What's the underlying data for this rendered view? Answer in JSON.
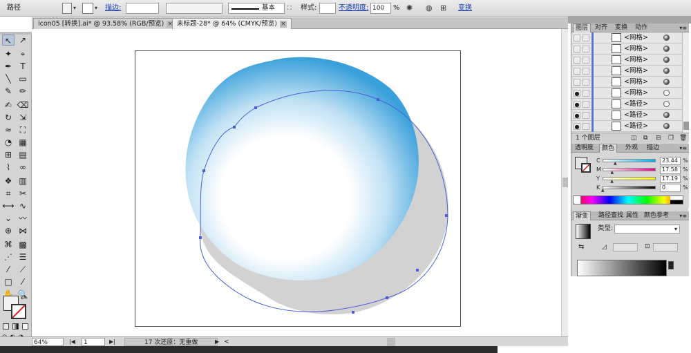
{
  "control_bar": {
    "selection_label": "路径",
    "stroke_label": "描边:",
    "brush_label": "基本",
    "style_label": "样式:",
    "opacity_label": "不透明度:",
    "opacity_value": "100",
    "opacity_unit": "%",
    "transform_link": "变换"
  },
  "tabs": [
    {
      "label": "icon05 [转换].ai* @ 93.58% (RGB/预览)",
      "active": false
    },
    {
      "label": "未标题-28* @ 64% (CMYK/预览)",
      "active": true
    }
  ],
  "tab_close_glyph": "×",
  "tools": [
    {
      "name": "selection-tool-icon",
      "glyph": "↖",
      "selected": true
    },
    {
      "name": "direct-selection-tool-icon",
      "glyph": "↗"
    },
    {
      "name": "magic-wand-tool-icon",
      "glyph": "✦"
    },
    {
      "name": "lasso-tool-icon",
      "glyph": "⌖"
    },
    {
      "name": "pen-tool-icon",
      "glyph": "✒"
    },
    {
      "name": "type-tool-icon",
      "glyph": "T"
    },
    {
      "name": "line-tool-icon",
      "glyph": "╲"
    },
    {
      "name": "rectangle-tool-icon",
      "glyph": "▭"
    },
    {
      "name": "paintbrush-tool-icon",
      "glyph": "✎"
    },
    {
      "name": "pencil-tool-icon",
      "glyph": "✏"
    },
    {
      "name": "blob-brush-tool-icon",
      "glyph": "✍"
    },
    {
      "name": "eraser-tool-icon",
      "glyph": "⌫"
    },
    {
      "name": "rotate-tool-icon",
      "glyph": "↻"
    },
    {
      "name": "scale-tool-icon",
      "glyph": "⇲"
    },
    {
      "name": "warp-tool-icon",
      "glyph": "≈"
    },
    {
      "name": "free-transform-tool-icon",
      "glyph": "⛶"
    },
    {
      "name": "shape-builder-tool-icon",
      "glyph": "◔"
    },
    {
      "name": "perspective-grid-tool-icon",
      "glyph": "▦"
    },
    {
      "name": "mesh-tool-icon",
      "glyph": "⊞"
    },
    {
      "name": "gradient-tool-icon",
      "glyph": "▤"
    },
    {
      "name": "eyedropper-tool-icon",
      "glyph": "⌇"
    },
    {
      "name": "blend-tool-icon",
      "glyph": "∞"
    },
    {
      "name": "symbol-sprayer-tool-icon",
      "glyph": "❖"
    },
    {
      "name": "column-graph-tool-icon",
      "glyph": "▥"
    },
    {
      "name": "artboard-tool-icon",
      "glyph": "⌗"
    },
    {
      "name": "slice-tool-icon",
      "glyph": "✂"
    },
    {
      "name": "width-tool-icon",
      "glyph": "⟷"
    },
    {
      "name": "curve-tool-icon",
      "glyph": "∿"
    },
    {
      "name": "anchor-convert-tool-icon",
      "glyph": "⌄"
    },
    {
      "name": "smooth-tool-icon",
      "glyph": "〰"
    },
    {
      "name": "crosshair-tool-icon",
      "glyph": "⊕"
    },
    {
      "name": "envelope-tool-icon",
      "glyph": "⋈"
    },
    {
      "name": "flare-tool-icon",
      "glyph": "⌘"
    },
    {
      "name": "bar-tool-icon",
      "glyph": "▩"
    },
    {
      "name": "graph-tool-icon",
      "glyph": "⋰"
    },
    {
      "name": "list-tool-icon",
      "glyph": "☰"
    },
    {
      "name": "eyedropper-alt-tool-icon",
      "glyph": "⁄"
    },
    {
      "name": "measure-tool-icon",
      "glyph": "⟋"
    },
    {
      "name": "rectangle-small-tool-icon",
      "glyph": "□"
    },
    {
      "name": "knife-tool-icon",
      "glyph": "⁄"
    },
    {
      "name": "hand-tool-icon",
      "glyph": "✋"
    },
    {
      "name": "zoom-tool-icon",
      "glyph": "🔍"
    }
  ],
  "status_bar": {
    "zoom": "64%",
    "artboard_number": "1",
    "undo_info": "17 次还原：无重做",
    "play_glyph": "▶",
    "left_arrow": "<"
  },
  "layers_panel": {
    "tabs": [
      "图层",
      "对齐",
      "变换",
      "动作"
    ],
    "rows": [
      {
        "name": "<网格>",
        "visible": false,
        "target_filled": true
      },
      {
        "name": "<网格>",
        "visible": false,
        "target_filled": true
      },
      {
        "name": "<网格>",
        "visible": false,
        "target_filled": true
      },
      {
        "name": "<网格>",
        "visible": false,
        "target_filled": true
      },
      {
        "name": "<网格>",
        "visible": false,
        "target_filled": true
      },
      {
        "name": "<网格>",
        "visible": true,
        "target_filled": false
      },
      {
        "name": "<路径>",
        "visible": true,
        "target_filled": false
      },
      {
        "name": "<路径>",
        "visible": true,
        "target_filled": true
      },
      {
        "name": "<路径>",
        "visible": true,
        "target_filled": true
      }
    ],
    "footer_label": "1 个图层"
  },
  "color_panel": {
    "tabs": [
      "透明度",
      "颜色",
      "外观",
      "描边"
    ],
    "rows": [
      {
        "label": "C",
        "value": "23.44",
        "position": 0.234,
        "gradient": "linear-gradient(to right,#fff,#00aeef)"
      },
      {
        "label": "M",
        "value": "17.58",
        "position": 0.176,
        "gradient": "linear-gradient(to right,#fff,#ec008c)"
      },
      {
        "label": "Y",
        "value": "17.19",
        "position": 0.172,
        "gradient": "linear-gradient(to right,#fff,#fff200)"
      },
      {
        "label": "K",
        "value": "0",
        "position": 0.0,
        "gradient": "linear-gradient(to right,#fff,#000)"
      }
    ],
    "unit": "%"
  },
  "gradient_panel": {
    "tabs": [
      "渐变",
      "路径查找",
      "属性",
      "颜色参考"
    ],
    "type_label": "类型:",
    "type_value": "▾"
  },
  "colors": {
    "bubble_dark": "#3aa0da",
    "bubble_light": "#ffffff",
    "shadow": "#d2d2d2",
    "path_outline": "#4a5fd6"
  }
}
